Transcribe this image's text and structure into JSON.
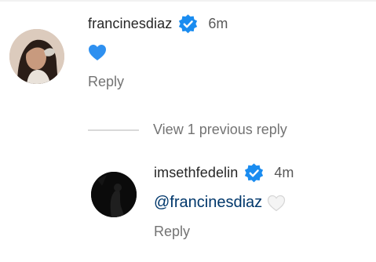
{
  "comments": [
    {
      "username": "francinesdiaz",
      "verified": true,
      "time": "6m",
      "body_icon": "blue-heart-icon",
      "reply_label": "Reply",
      "avatar": "profile-photo"
    }
  ],
  "view_replies": {
    "label": "View 1 previous reply"
  },
  "replies": [
    {
      "username": "imsethfedelin",
      "verified": true,
      "time": "4m",
      "mention": "@francinesdiaz",
      "body_icon": "white-heart-icon",
      "reply_label": "Reply",
      "avatar": "profile-photo"
    }
  ],
  "colors": {
    "verified_badge": "#1a8cf0",
    "mention": "#00376b",
    "blue_heart": "#2e90f0",
    "secondary_text": "#737373"
  }
}
